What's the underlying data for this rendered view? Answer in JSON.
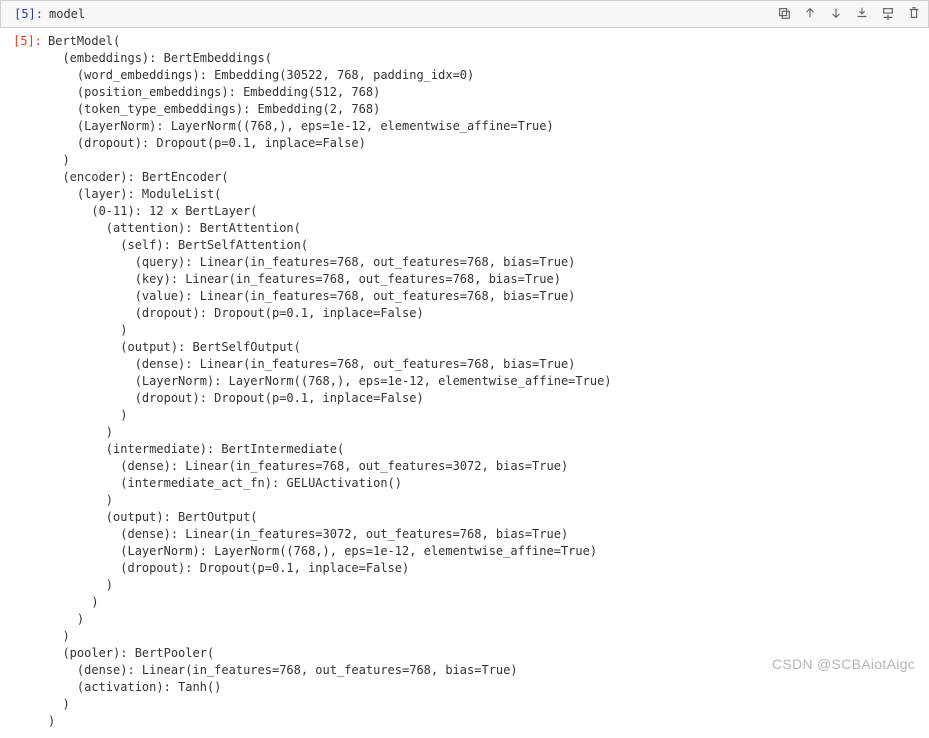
{
  "input_prompt": "[5]:",
  "output_prompt": "[5]:",
  "input_code": "model",
  "output_text": "BertModel(\n  (embeddings): BertEmbeddings(\n    (word_embeddings): Embedding(30522, 768, padding_idx=0)\n    (position_embeddings): Embedding(512, 768)\n    (token_type_embeddings): Embedding(2, 768)\n    (LayerNorm): LayerNorm((768,), eps=1e-12, elementwise_affine=True)\n    (dropout): Dropout(p=0.1, inplace=False)\n  )\n  (encoder): BertEncoder(\n    (layer): ModuleList(\n      (0-11): 12 x BertLayer(\n        (attention): BertAttention(\n          (self): BertSelfAttention(\n            (query): Linear(in_features=768, out_features=768, bias=True)\n            (key): Linear(in_features=768, out_features=768, bias=True)\n            (value): Linear(in_features=768, out_features=768, bias=True)\n            (dropout): Dropout(p=0.1, inplace=False)\n          )\n          (output): BertSelfOutput(\n            (dense): Linear(in_features=768, out_features=768, bias=True)\n            (LayerNorm): LayerNorm((768,), eps=1e-12, elementwise_affine=True)\n            (dropout): Dropout(p=0.1, inplace=False)\n          )\n        )\n        (intermediate): BertIntermediate(\n          (dense): Linear(in_features=768, out_features=3072, bias=True)\n          (intermediate_act_fn): GELUActivation()\n        )\n        (output): BertOutput(\n          (dense): Linear(in_features=3072, out_features=768, bias=True)\n          (LayerNorm): LayerNorm((768,), eps=1e-12, elementwise_affine=True)\n          (dropout): Dropout(p=0.1, inplace=False)\n        )\n      )\n    )\n  )\n  (pooler): BertPooler(\n    (dense): Linear(in_features=768, out_features=768, bias=True)\n    (activation): Tanh()\n  )\n)",
  "toolbar": {
    "duplicate": "duplicate",
    "move_up": "move-up",
    "move_down": "move-down",
    "download": "download",
    "insert_below": "insert-below",
    "delete": "delete"
  },
  "watermark": "CSDN @SCBAiotAigc"
}
